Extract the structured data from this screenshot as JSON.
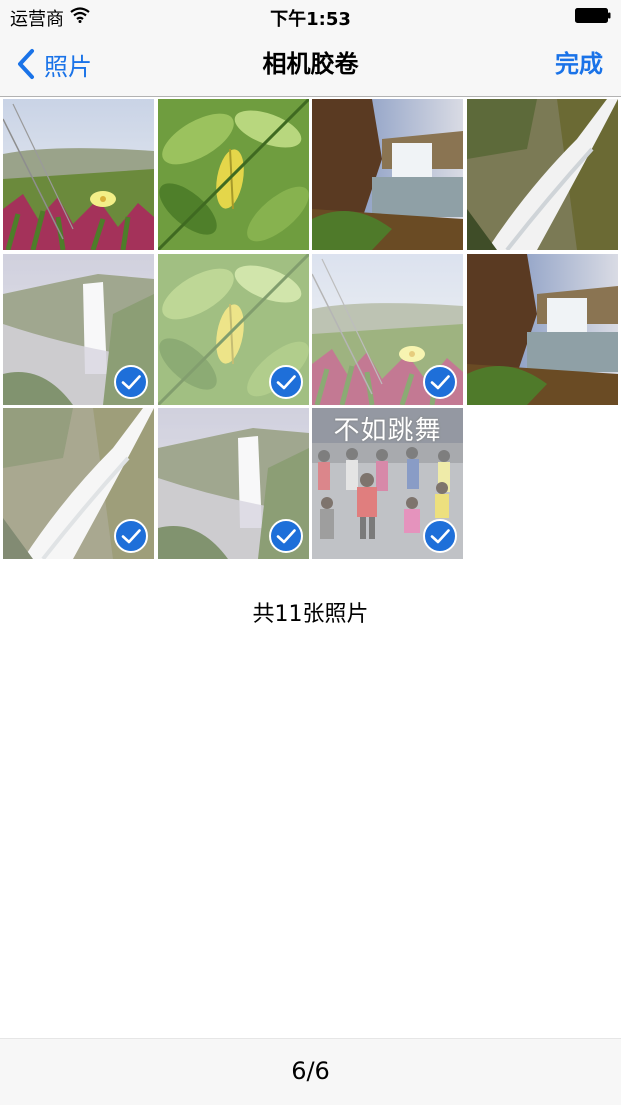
{
  "status_bar": {
    "carrier": "运营商",
    "time": "下午1:53"
  },
  "nav": {
    "back_label": "照片",
    "title": "相机胶卷",
    "done_label": "完成"
  },
  "photos": [
    {
      "scene": "flower",
      "selected": false
    },
    {
      "scene": "leaves",
      "selected": false
    },
    {
      "scene": "waterfall-wide",
      "selected": false
    },
    {
      "scene": "waterfall-close",
      "selected": false
    },
    {
      "scene": "waterfall-misty",
      "selected": true
    },
    {
      "scene": "leaves",
      "selected": true
    },
    {
      "scene": "flower",
      "selected": true
    },
    {
      "scene": "waterfall-wide",
      "selected": false
    },
    {
      "scene": "waterfall-close",
      "selected": true
    },
    {
      "scene": "waterfall-misty",
      "selected": true
    },
    {
      "scene": "crowd",
      "selected": true,
      "overlay_text": "不如跳舞"
    }
  ],
  "photo_count_text": "共11张照片",
  "page_indicator": "6/6",
  "colors": {
    "accent": "#1a73e8",
    "check": "#1e6fd9"
  }
}
